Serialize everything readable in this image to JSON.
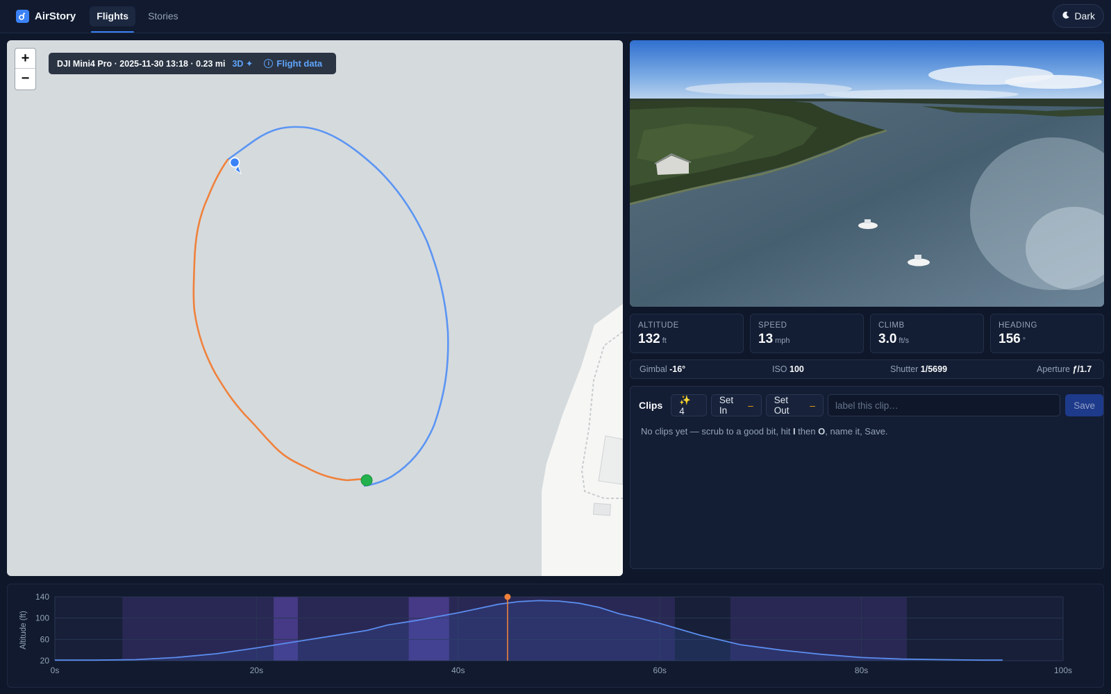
{
  "app": {
    "name": "AirStory",
    "tabs": [
      {
        "label": "Flights",
        "active": true
      },
      {
        "label": "Stories",
        "active": false
      }
    ],
    "theme_toggle": "Dark"
  },
  "map": {
    "zoom_in": "+",
    "zoom_out": "−",
    "flight_title": "DJI Mini4 Pro · 2025-11-30 13:18 · 0.23 mi",
    "mode_badge": "3D ✦",
    "flight_data_link": "Flight data",
    "track_colors": {
      "flown": "#f0813b",
      "remaining": "#5b95f3",
      "start": "#22b14c"
    }
  },
  "telemetry": [
    {
      "label": "ALTITUDE",
      "value": "132",
      "unit": "ft"
    },
    {
      "label": "SPEED",
      "value": "13",
      "unit": "mph"
    },
    {
      "label": "CLIMB",
      "value": "3.0",
      "unit": "ft/s"
    },
    {
      "label": "HEADING",
      "value": "156",
      "unit": "°"
    }
  ],
  "camera": {
    "gimbal_label": "Gimbal",
    "gimbal_value": "-16°",
    "iso_label": "ISO",
    "iso_value": "100",
    "shutter_label": "Shutter",
    "shutter_value": "1/5699",
    "aperture_label": "Aperture",
    "aperture_value": "ƒ/1.7"
  },
  "clips": {
    "title": "Clips",
    "auto_count": "✨ 4",
    "set_in": "Set In",
    "set_in_value": "–",
    "set_out": "Set Out",
    "set_out_value": "–",
    "label_placeholder": "label this clip…",
    "save": "Save",
    "empty_pre": "No clips yet — scrub to a good bit, hit ",
    "empty_key1": "I",
    "empty_mid": " then ",
    "empty_key2": "O",
    "empty_post": ", name it, Save."
  },
  "chart_data": {
    "type": "area",
    "ylabel": "Altitude (ft)",
    "y_ticks": [
      "140",
      "100",
      "60",
      "20"
    ],
    "x_ticks": [
      "0s",
      "20s",
      "40s",
      "60s",
      "80s",
      "100s"
    ],
    "xlim": [
      0,
      100
    ],
    "ylim": [
      20,
      140
    ],
    "x": [
      0,
      4,
      8,
      12,
      16,
      20,
      24,
      28,
      30,
      31,
      33,
      36,
      40,
      42,
      44,
      46,
      48,
      50,
      52,
      54,
      56,
      58,
      60,
      64,
      68,
      72,
      76,
      80,
      84,
      88,
      92,
      94
    ],
    "values": [
      21,
      21,
      22,
      26,
      33,
      44,
      56,
      68,
      74,
      77,
      87,
      96,
      110,
      118,
      126,
      131,
      133,
      132,
      128,
      120,
      108,
      100,
      90,
      68,
      50,
      40,
      32,
      26,
      23,
      22,
      21,
      21
    ],
    "playhead": 44.9,
    "highlight_bands": [
      [
        6.7,
        61.5
      ],
      [
        67,
        84.5
      ]
    ],
    "strong_bands": [
      [
        21.7,
        24.1
      ],
      [
        35.1,
        39.1
      ]
    ],
    "line_color": "#5b8def",
    "playhead_color": "#f0813b"
  }
}
